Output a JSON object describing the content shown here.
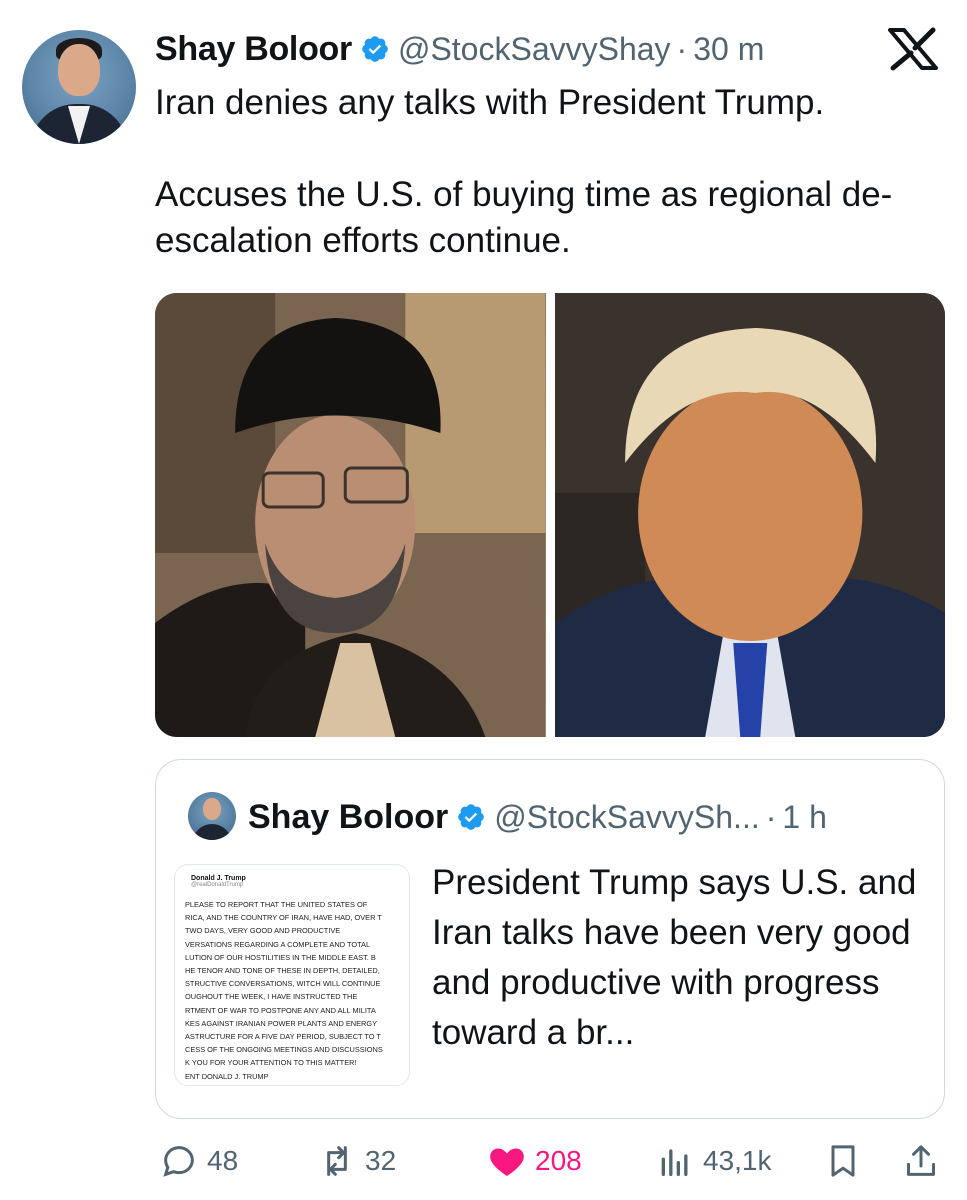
{
  "post": {
    "author_name": "Shay Boloor",
    "handle": "@StockSavvyShay",
    "separator": "·",
    "time": "30 m",
    "text_1": "Iran denies any talks with President Trump.",
    "text_2": "Accuses the U.S. of buying time as regional de-escalation efforts continue."
  },
  "quoted_post": {
    "author_name": "Shay Boloor",
    "handle": "@StockSavvySh...",
    "separator": "·",
    "time": "1 h",
    "text": "President Trump says U.S. and Iran talks have been very good and productive with progress toward a br...",
    "thumbnail": {
      "name": "Donald J. Trump",
      "handle": "@realDonaldTrump",
      "lines": [
        "PLEASE TO REPORT THAT THE UNITED STATES OF",
        "RICA, AND THE COUNTRY OF IRAN, HAVE HAD, OVER T",
        "TWO DAYS, VERY GOOD AND PRODUCTIVE",
        "VERSATIONS REGARDING A COMPLETE AND TOTAL",
        "LUTION OF OUR HOSTILITIES IN THE MIDDLE EAST. B",
        "HE TENOR AND TONE OF THESE IN DEPTH, DETAILED,",
        "STRUCTIVE CONVERSATIONS, WITCH WILL CONTINUE",
        "OUGHOUT THE WEEK, I HAVE INSTRUCTED THE",
        "RTMENT OF WAR TO POSTPONE ANY AND ALL MILITA",
        "KES AGAINST IRANIAN POWER PLANTS AND ENERGY",
        "ASTRUCTURE FOR A FIVE DAY PERIOD, SUBJECT TO T",
        "CESS OF THE ONGOING MEETINGS AND DISCUSSIONS",
        "K YOU FOR YOUR ATTENTION TO THIS MATTER!",
        "ENT DONALD J. TRUMP"
      ]
    }
  },
  "actions": {
    "replies": "48",
    "reposts": "32",
    "likes": "208",
    "views": "43,1k"
  },
  "icons": {
    "verified": "verified-badge-icon",
    "platform": "x-logo-icon",
    "reply": "reply-icon",
    "repost": "repost-icon",
    "like": "heart-icon",
    "views": "views-chart-icon",
    "bookmark": "bookmark-icon",
    "share": "share-icon"
  },
  "colors": {
    "verified_blue": "#1d9bf0",
    "like_pink": "#f91880",
    "muted_text": "#536471",
    "border": "#cfd9de"
  }
}
